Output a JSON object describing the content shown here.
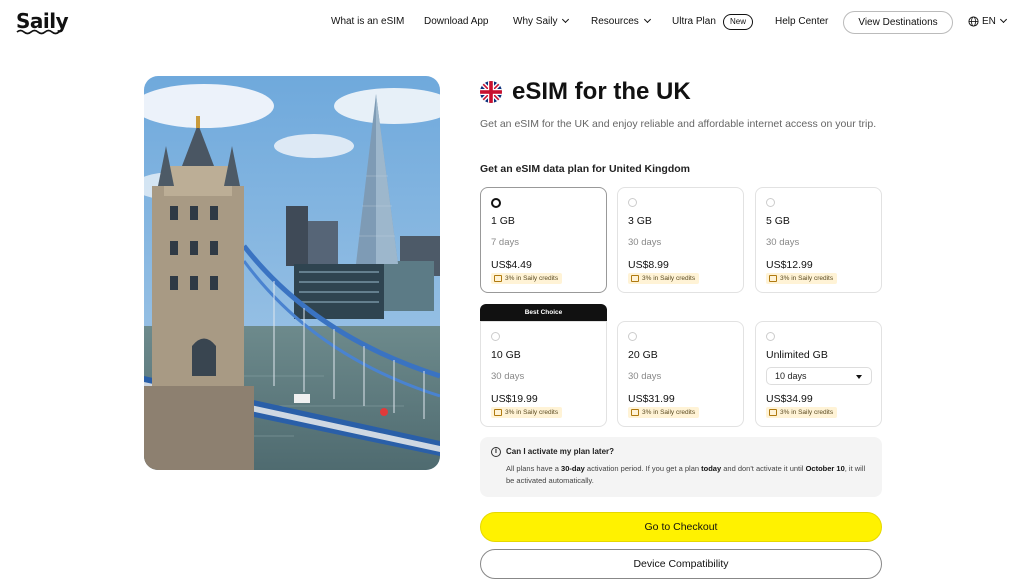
{
  "brand": {
    "name": "Saily"
  },
  "nav": {
    "items": [
      {
        "label": "What is an eSIM"
      },
      {
        "label": "Download App"
      },
      {
        "label": "Why Saily"
      },
      {
        "label": "Resources"
      },
      {
        "label": "Ultra Plan"
      },
      {
        "label": "Help Center"
      }
    ],
    "new_badge": "New",
    "cta": "View Destinations",
    "language": "EN",
    "icons": {
      "language": "globe-icon",
      "dropdown": "chevron-down-icon"
    }
  },
  "hero": {
    "image": "London Tower Bridge and The Shard photo"
  },
  "product": {
    "flag_icon": "uk-flag-icon",
    "title": "eSIM for the UK",
    "subtitle": "Get an eSIM for the UK and enjoy reliable and affordable internet access on your trip.",
    "plans_heading": "Get an eSIM data plan for United Kingdom"
  },
  "plans": [
    {
      "data": "1 GB",
      "duration": "7 days",
      "price": "US$4.49",
      "credits": "3% in Saily credits",
      "selected": true
    },
    {
      "data": "3 GB",
      "duration": "30 days",
      "price": "US$8.99",
      "credits": "3% in Saily credits",
      "selected": false
    },
    {
      "data": "5 GB",
      "duration": "30 days",
      "price": "US$12.99",
      "credits": "3% in Saily credits",
      "selected": false
    },
    {
      "data": "10 GB",
      "duration": "30 days",
      "price": "US$19.99",
      "credits": "3% in Saily credits",
      "selected": false,
      "tag": "Best Choice"
    },
    {
      "data": "20 GB",
      "duration": "30 days",
      "price": "US$31.99",
      "credits": "3% in Saily credits",
      "selected": false
    },
    {
      "data": "Unlimited GB",
      "duration": "10 days",
      "price": "US$34.99",
      "credits": "3% in Saily credits",
      "selected": false
    }
  ],
  "info": {
    "question": "Can I activate my plan later?",
    "answer_1": "All plans have a ",
    "answer_b1": "30-day",
    "answer_2": " activation period. If you get a plan ",
    "answer_b2": "today",
    "answer_3": " and don't activate it until ",
    "answer_b3": "October 10",
    "answer_4": ", it will be activated automatically.",
    "icon": "info-icon"
  },
  "actions": {
    "checkout": "Go to Checkout",
    "compatibility": "Device Compatibility"
  },
  "colors": {
    "accent": "#fff200",
    "dark": "#111111",
    "credits_bg": "#fff3d6"
  }
}
